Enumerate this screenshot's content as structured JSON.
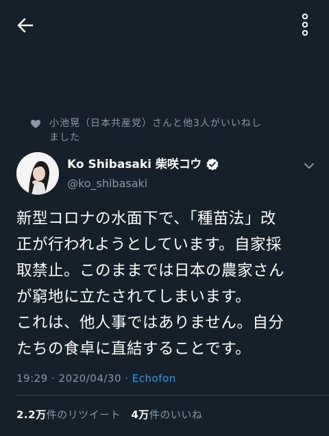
{
  "header": {
    "back_icon": "arrow-left-icon",
    "more_icon": "more-vertical-icon"
  },
  "social_context": {
    "text": "小池晃（日本共産党）さんと他3人がいいねしました",
    "line1": "小池晃（日本共産党）さんと他3人がいいねし",
    "line2": "ました",
    "icon": "heart-icon"
  },
  "author": {
    "display_name": "Ko Shibasaki 柴咲コウ",
    "handle": "@ko_shibasaki",
    "verified_icon": "verified-badge-icon"
  },
  "tweet": {
    "lines": [
      "新型コロナの水面下で、「種苗法」改",
      "正が行われようとしています。自家採",
      "取禁止。このままでは日本の農家さん",
      "が窮地に立たされてしまいます。",
      "これは、他人事ではありません。自分",
      "たちの食卓に直結することです。"
    ]
  },
  "meta": {
    "time": "19:29",
    "date": "2020/04/30",
    "separator": " · ",
    "source": "Echofon"
  },
  "stats": {
    "retweets_count": "2.2万",
    "retweets_label": "件のリツイート",
    "likes_count": "4万",
    "likes_label": "件のいいね"
  },
  "colors": {
    "background": "#15202b",
    "secondary_text": "#8b98a5",
    "accent": "#1da1f2",
    "divider": "#38444d"
  }
}
